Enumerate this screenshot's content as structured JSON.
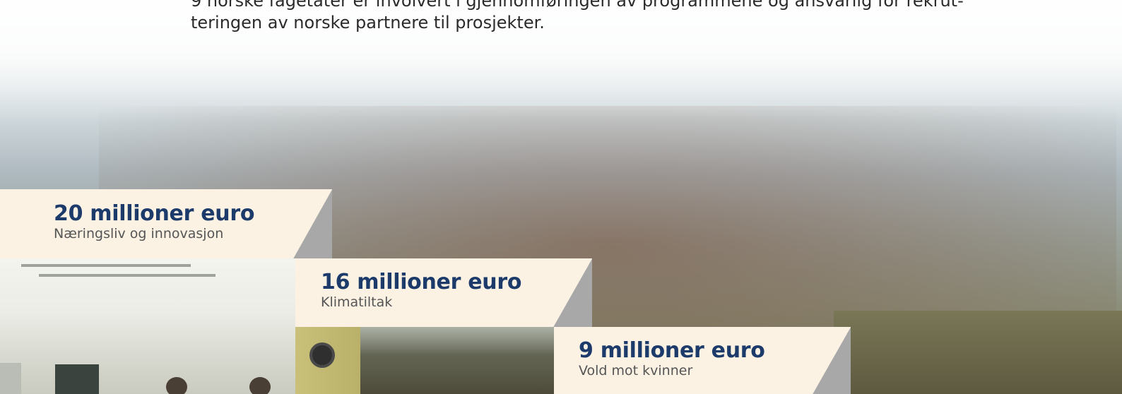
{
  "intro_text": "9 norske fagetater er involvert i gjennomføringen av programmene og ansvarlig for rekrut-teringen av norske partnere til prosjekter.",
  "funding_items": [
    {
      "amount": "20 millioner euro",
      "area": "Næringsliv og innovasjon"
    },
    {
      "amount": "16 millioner euro",
      "area": "Klimatiltak"
    },
    {
      "amount": "9 millioner euro",
      "area": "Vold mot kvinner"
    }
  ],
  "colors": {
    "label_background": "#fbf2e4",
    "amount_text": "#1c3a6a",
    "area_text": "#555555",
    "wedge": "#a8a8a8"
  }
}
